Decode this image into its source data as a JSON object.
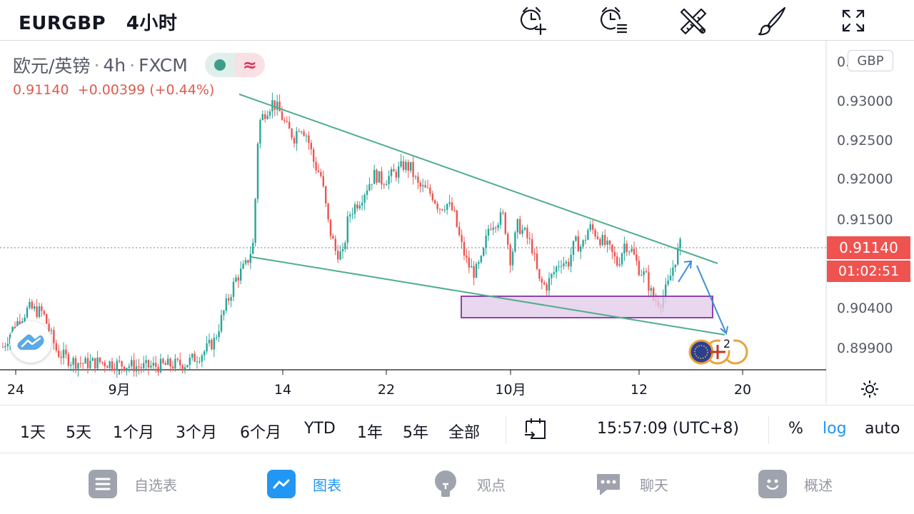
{
  "header": {
    "symbol": "EURGBP",
    "interval": "4小时",
    "tools": [
      "alarm-add-icon",
      "alarm-list-icon",
      "drawing-tools-icon",
      "brush-icon",
      "fullscreen-icon"
    ]
  },
  "legend": {
    "name": "欧元/英镑",
    "interval": "4h",
    "exchange": "FXCM",
    "last": "0.91140",
    "change": "+0.00399",
    "change_pct": "(+0.44%)"
  },
  "price_axis": {
    "currency": "GBP",
    "tick_labels": [
      "0.",
      "0.93000",
      "0.92500",
      "0.92000",
      "0.91500",
      "0.90400",
      "0.89900"
    ],
    "current_price": "0.91140",
    "countdown": "01:02:51"
  },
  "time_axis": {
    "tick_labels": [
      "24",
      "9月",
      "14",
      "22",
      "10月",
      "12",
      "20"
    ]
  },
  "events_badge": "2",
  "range_bar": {
    "ranges": [
      "1天",
      "5天",
      "1个月",
      "3个月",
      "6个月",
      "YTD",
      "1年",
      "5年",
      "全部"
    ],
    "clock": "15:57:09 (UTC+8)",
    "percent": "%",
    "log": "log",
    "auto": "auto"
  },
  "bottom_nav": {
    "items": [
      {
        "label": "自选表",
        "icon": "watchlist-icon"
      },
      {
        "label": "图表",
        "icon": "chart-icon"
      },
      {
        "label": "观点",
        "icon": "ideas-icon"
      },
      {
        "label": "聊天",
        "icon": "chat-icon"
      },
      {
        "label": "概述",
        "icon": "overview-icon"
      }
    ],
    "active_index": 1
  },
  "colors": {
    "up": "#26a69a",
    "down": "#ef5350",
    "accent": "#2196f3",
    "trendline": "#4fae8c",
    "zone_fill": "#e2cdea",
    "zone_border": "#8e44ad"
  },
  "chart_data": {
    "type": "candlestick",
    "symbol": "EURGBP",
    "timeframe": "4h",
    "last_price": 0.9114,
    "price_range": [
      0.8965,
      0.934
    ],
    "key_levels": [
      0.904,
      0.899
    ],
    "price_zone": [
      0.9031,
      0.9053
    ],
    "path": [
      [
        0,
        0.8985
      ],
      [
        20,
        0.9015
      ],
      [
        40,
        0.9035
      ],
      [
        60,
        0.903
      ],
      [
        80,
        0.8985
      ],
      [
        100,
        0.8975
      ],
      [
        120,
        0.8972
      ],
      [
        140,
        0.8974
      ],
      [
        160,
        0.8972
      ],
      [
        200,
        0.8968
      ],
      [
        260,
        0.8972
      ],
      [
        285,
        0.8985
      ],
      [
        300,
        0.8998
      ],
      [
        315,
        0.9035
      ],
      [
        330,
        0.9068
      ],
      [
        345,
        0.9085
      ],
      [
        355,
        0.911
      ],
      [
        362,
        0.9245
      ],
      [
        372,
        0.926
      ],
      [
        382,
        0.927
      ],
      [
        392,
        0.9258
      ],
      [
        402,
        0.924
      ],
      [
        412,
        0.923
      ],
      [
        420,
        0.9245
      ],
      [
        430,
        0.9232
      ],
      [
        440,
        0.92
      ],
      [
        450,
        0.9185
      ],
      [
        460,
        0.913
      ],
      [
        470,
        0.91
      ],
      [
        480,
        0.9095
      ],
      [
        488,
        0.914
      ],
      [
        495,
        0.915
      ],
      [
        505,
        0.916
      ],
      [
        515,
        0.9175
      ],
      [
        525,
        0.9188
      ],
      [
        535,
        0.918
      ],
      [
        545,
        0.9185
      ],
      [
        555,
        0.919
      ],
      [
        565,
        0.9198
      ],
      [
        575,
        0.9195
      ],
      [
        585,
        0.9175
      ],
      [
        595,
        0.917
      ],
      [
        605,
        0.9165
      ],
      [
        615,
        0.915
      ],
      [
        625,
        0.9155
      ],
      [
        635,
        0.9145
      ],
      [
        645,
        0.911
      ],
      [
        655,
        0.9085
      ],
      [
        665,
        0.9075
      ],
      [
        675,
        0.909
      ],
      [
        685,
        0.913
      ],
      [
        695,
        0.9135
      ],
      [
        705,
        0.914
      ],
      [
        715,
        0.909
      ],
      [
        725,
        0.913
      ],
      [
        735,
        0.912
      ],
      [
        745,
        0.9105
      ],
      [
        755,
        0.9065
      ],
      [
        765,
        0.906
      ],
      [
        775,
        0.9075
      ],
      [
        785,
        0.909
      ],
      [
        795,
        0.9085
      ],
      [
        805,
        0.911
      ],
      [
        815,
        0.9105
      ],
      [
        825,
        0.9128
      ],
      [
        835,
        0.912
      ],
      [
        845,
        0.911
      ],
      [
        855,
        0.91
      ],
      [
        865,
        0.9085
      ],
      [
        875,
        0.911
      ],
      [
        885,
        0.91
      ],
      [
        895,
        0.908
      ],
      [
        905,
        0.907
      ],
      [
        915,
        0.9045
      ],
      [
        925,
        0.9043
      ],
      [
        935,
        0.906
      ],
      [
        945,
        0.909
      ],
      [
        955,
        0.9112
      ]
    ],
    "annotations": [
      "falling wedge: upper trendline and lower trendline",
      "support zone rectangle",
      "blue projection arrows up then down"
    ]
  }
}
